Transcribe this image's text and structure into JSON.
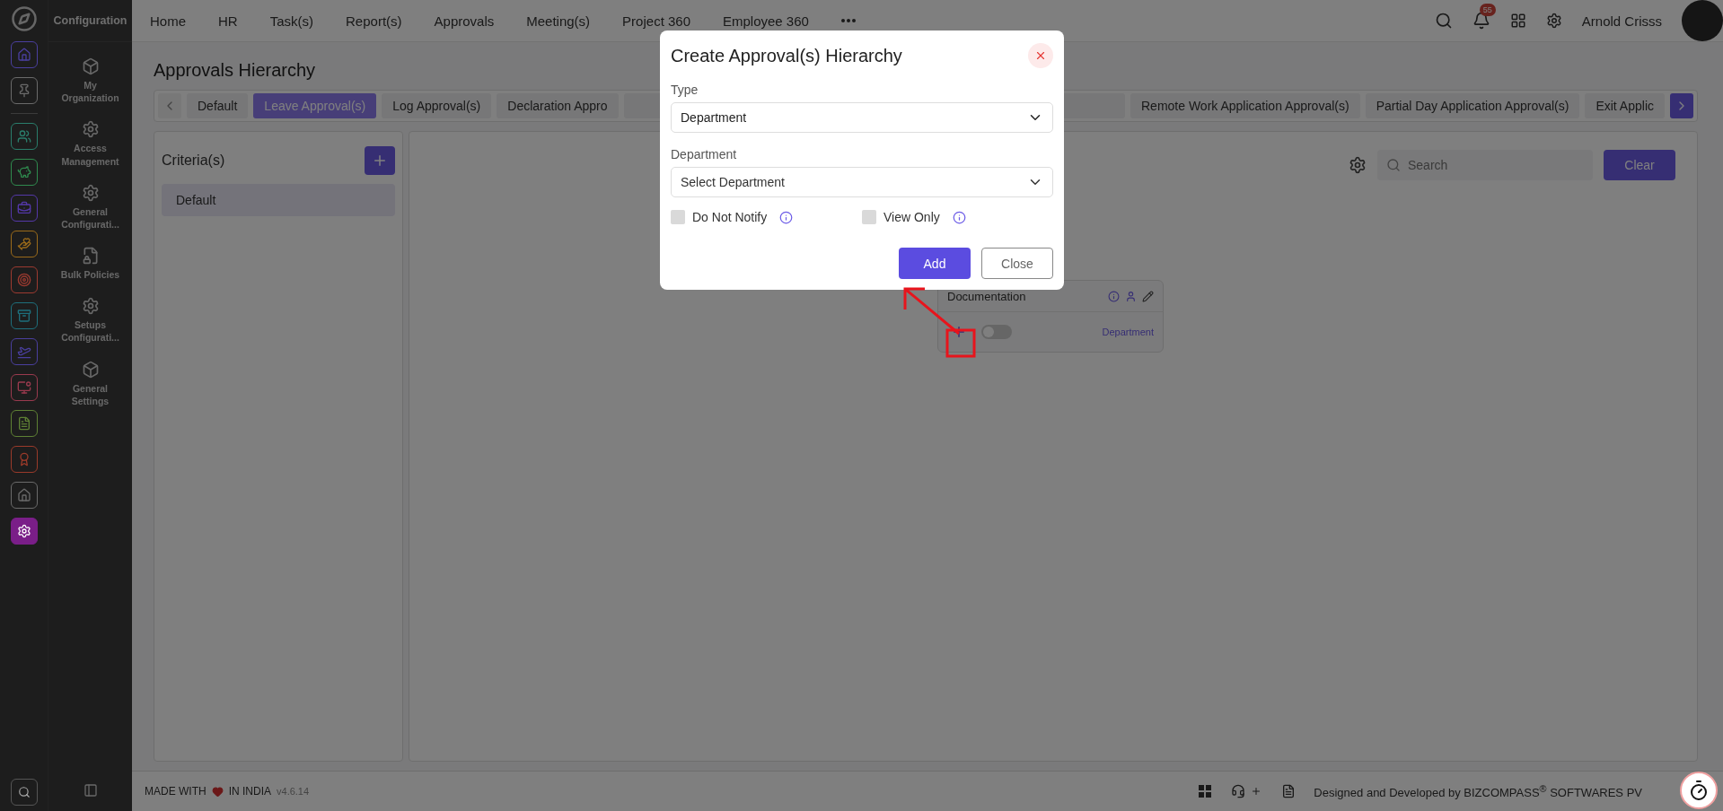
{
  "rail": {
    "pinned": [
      {
        "color": "#4a3f9e",
        "selected": false
      },
      {
        "color": "#6a6a6a",
        "selected": false
      }
    ],
    "apps": [
      {
        "color": "#2a7d6b",
        "selected": false
      },
      {
        "color": "#2f8a4e",
        "selected": false
      },
      {
        "color": "#5438a8",
        "selected": false
      },
      {
        "color": "#9a6a1a",
        "selected": false
      },
      {
        "color": "#9c3a30",
        "selected": false
      },
      {
        "color": "#1e6f7c",
        "selected": false
      },
      {
        "color": "#4a3f9e",
        "selected": false
      },
      {
        "color": "#9a3a4e",
        "selected": false
      },
      {
        "color": "#5e8034",
        "selected": false
      },
      {
        "color": "#9a3a2a",
        "selected": false
      },
      {
        "color": "#6a6a6a",
        "selected": false
      },
      {
        "color": "#7a1e88",
        "selected": true
      }
    ]
  },
  "module_title": "Configuration",
  "subnav": [
    {
      "label": "My Organization"
    },
    {
      "label": "Access Management"
    },
    {
      "label": "General Configurati..."
    },
    {
      "label": "Bulk Policies"
    },
    {
      "label": "Setups Configurati..."
    },
    {
      "label": "General Settings"
    }
  ],
  "top_menu": [
    "Home",
    "HR",
    "Task(s)",
    "Report(s)",
    "Approvals",
    "Meeting(s)",
    "Project 360",
    "Employee 360"
  ],
  "user": {
    "name": "Arnold Crisss",
    "notifications": "55"
  },
  "page_title": "Approvals Hierarchy",
  "tabs_left": [
    {
      "label": "Default",
      "selected": false
    },
    {
      "label": "Leave Approval(s)",
      "selected": true
    },
    {
      "label": "Log Approval(s)",
      "selected": false
    },
    {
      "label": "Declaration Appro",
      "selected": false
    }
  ],
  "tabs_right": [
    {
      "label": "Remote Work Application Approval(s)",
      "selected": false
    },
    {
      "label": "Partial Day Application Approval(s)",
      "selected": false
    },
    {
      "label": "Exit Applic",
      "selected": false
    }
  ],
  "criteria": {
    "title": "Criteria(s)",
    "items": [
      {
        "label": "Default",
        "selected": true
      }
    ]
  },
  "toolbar": {
    "search_placeholder": "Search",
    "clear": "Clear"
  },
  "node": {
    "title": "Documentation",
    "on": false,
    "type": "Department"
  },
  "modal": {
    "title": "Create Approval(s) Hierarchy",
    "type_label": "Type",
    "type_value": "Department",
    "department_label": "Department",
    "department_placeholder": "Select Department",
    "options": [
      {
        "label": "Do Not Notify",
        "checked": false
      },
      {
        "label": "View Only",
        "checked": false
      }
    ],
    "add": "Add",
    "close": "Close"
  },
  "footer": {
    "made_with": "MADE WITH",
    "in_india": "IN INDIA",
    "version": "v4.6.14",
    "credit": "Designed and Developed by  BIZCOMPASS$^{®}$ SOFTWARES PV"
  }
}
